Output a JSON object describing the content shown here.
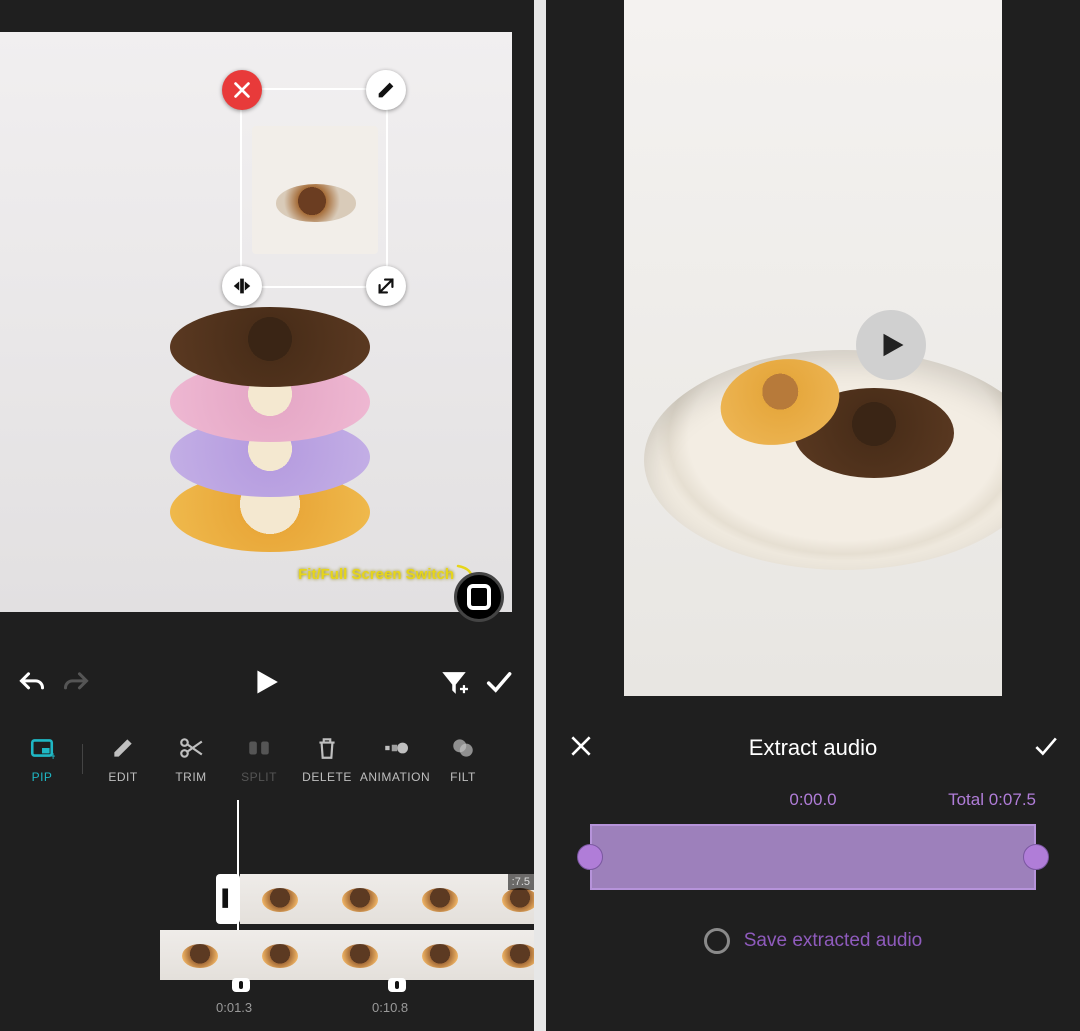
{
  "left": {
    "tools": {
      "pip": "PIP",
      "edit": "EDIT",
      "trim": "TRIM",
      "split": "SPLIT",
      "delete": "DELETE",
      "animation": "ANIMATION",
      "filter": "FILT"
    },
    "overlay": {
      "fit_full_label": "Fit/Full Screen Switch"
    },
    "timeline": {
      "main_clip_duration_badge": ":7.5",
      "marker_a": "0:01.3",
      "marker_b": "0:10.8"
    },
    "colors": {
      "tool_active": "#1fb7c4"
    }
  },
  "right": {
    "title": "Extract audio",
    "current_time": "0:00.0",
    "total_label": "Total 0:07.5",
    "save_label": "Save extracted audio",
    "colors": {
      "accent": "#b07dd8",
      "range_fill": "#9d80bb"
    }
  }
}
